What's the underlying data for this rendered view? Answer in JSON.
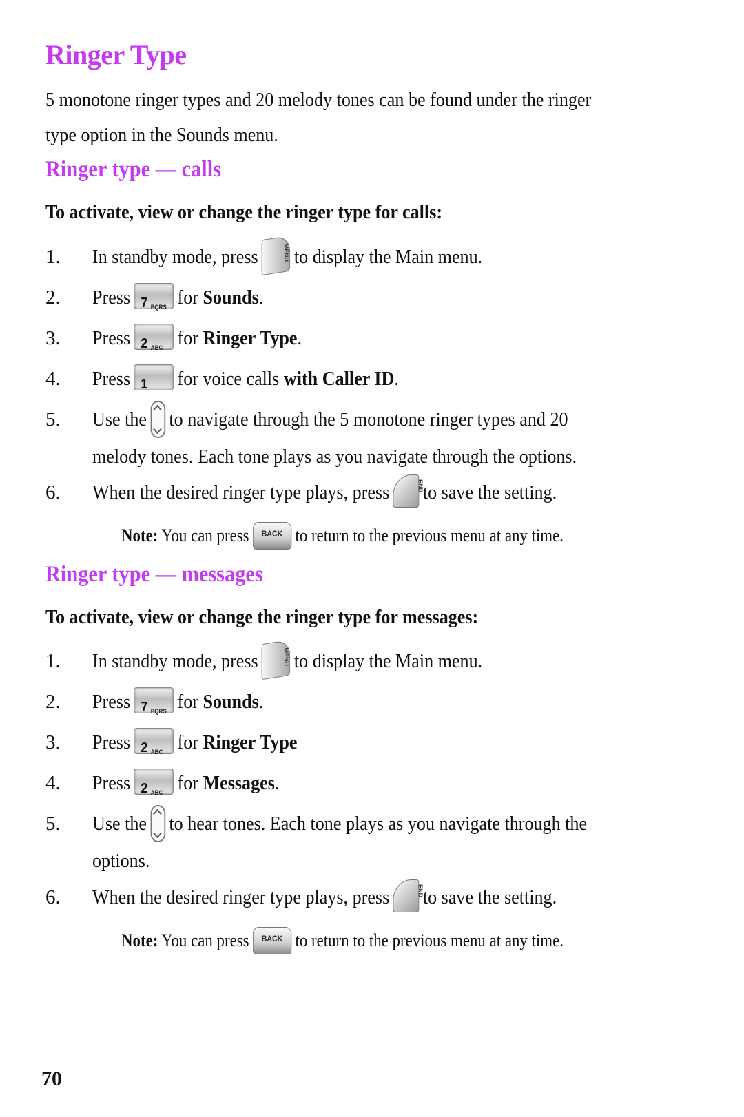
{
  "title": "Ringer Type",
  "intro": "5 monotone ringer types and 20 melody tones can be found under the ringer type option in the Sounds menu.",
  "intro_line1": "5 monotone ringer types and 20 melody tones can be found under the ringer",
  "intro_line2": "type option in the Sounds menu.",
  "accent_color": "#c43af0",
  "sections": [
    {
      "heading": "Ringer type — calls",
      "lead": "To activate, view or change the ringer type for calls:",
      "steps": [
        {
          "num": "1.",
          "pre": "In standby mode, press",
          "key": "menu-key-icon",
          "key_label": "MENU",
          "post": "to display the Main menu."
        },
        {
          "num": "2.",
          "pre": "Press",
          "key": "key-7-icon",
          "key_label": "7",
          "key_sub": "PQRS",
          "post": "for ",
          "bold": "Sounds",
          "end": "."
        },
        {
          "num": "3.",
          "pre": "Press",
          "key": "key-2-icon",
          "key_label": "2",
          "key_sub": "ABC",
          "post": "for ",
          "bold": "Ringer Type",
          "end": "."
        },
        {
          "num": "4.",
          "pre": "Press",
          "key": "key-1-icon",
          "key_label": "1",
          "post": "for voice calls ",
          "bold": "with Caller ID",
          "end": "."
        },
        {
          "num": "5.",
          "pre": "Use the",
          "key": "navigation-key-icon",
          "post": "to navigate through the 5 monotone ringer types and 20",
          "line2": "melody tones. Each tone plays as you navigate through the options."
        },
        {
          "num": "6.",
          "pre": "When the desired ringer type plays, press",
          "key": "end-key-icon",
          "key_label": "END",
          "post": "to save the setting."
        }
      ],
      "note_label": "Note:",
      "note_pre": "You can press",
      "note_key_label": "BACK",
      "note_post": "to return to the previous menu at any time."
    },
    {
      "heading": "Ringer type — messages",
      "lead": "To activate, view or change the ringer type for messages:",
      "steps": [
        {
          "num": "1.",
          "pre": "In standby mode, press",
          "key": "menu-key-icon",
          "key_label": "MENU",
          "post": "to display the Main menu."
        },
        {
          "num": "2.",
          "pre": "Press",
          "key": "key-7-icon",
          "key_label": "7",
          "key_sub": "PQRS",
          "post": "for ",
          "bold": "Sounds",
          "end": "."
        },
        {
          "num": "3.",
          "pre": "Press",
          "key": "key-2-icon",
          "key_label": "2",
          "key_sub": "ABC",
          "post": "for ",
          "bold": "Ringer Type",
          "end": ""
        },
        {
          "num": "4.",
          "pre": "Press",
          "key": "key-2-icon",
          "key_label": "2",
          "key_sub": "ABC",
          "post": "for ",
          "bold": "Messages",
          "end": "."
        },
        {
          "num": "5.",
          "pre": "Use the",
          "key": "navigation-key-icon",
          "post": "to hear tones. Each tone plays as you navigate through the",
          "line2": "options."
        },
        {
          "num": "6.",
          "pre": "When the desired ringer type plays, press",
          "key": "end-key-icon",
          "key_label": "END",
          "post": "to save the setting."
        }
      ],
      "note_label": "Note:",
      "note_pre": "You can press",
      "note_key_label": "BACK",
      "note_post": "to return to the previous menu at any time."
    }
  ],
  "page_number": "70"
}
